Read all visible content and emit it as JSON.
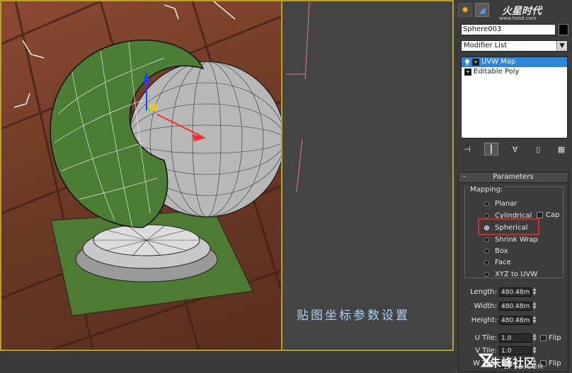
{
  "viewport": {
    "caption": "贴图坐标参数设置"
  },
  "panel": {
    "logo": "火星时代",
    "logo_sub": "www.hxsd.com",
    "object_name": "Sphere003",
    "modifier_list": "Modifier List",
    "stack": [
      {
        "label": "UVW Map",
        "selected": true
      },
      {
        "label": "Editable Poly",
        "selected": false
      }
    ],
    "rollout_title": "Parameters",
    "rollout_toggle": "-",
    "mapping_label": "Mapping:",
    "mapping_options": [
      "Planar",
      "Cylindrical",
      "Spherical",
      "Shrink Wrap",
      "Box",
      "Face",
      "XYZ to UVW"
    ],
    "selected_mapping": "Spherical",
    "cap_label": "Cap",
    "length_label": "Length:",
    "length_value": "480.48m",
    "width_label": "Width:",
    "width_value": "480.48m",
    "height_label": "Height:",
    "height_value": "480.48m",
    "utile_label": "U Tile:",
    "utile_value": "1.0",
    "vtile_label": "V Tile:",
    "vtile_value": "1.0",
    "wtile_label": "W Tile:",
    "wtile_value": "1.0",
    "flip_label": "Flip"
  },
  "watermark": {
    "text": "朱峰社区",
    "sub": "ZF3D.COM"
  },
  "colors": {
    "viewport_border": "#b9a02a",
    "selection_blue": "#2d86d9",
    "highlight_red": "#d42a2a"
  }
}
